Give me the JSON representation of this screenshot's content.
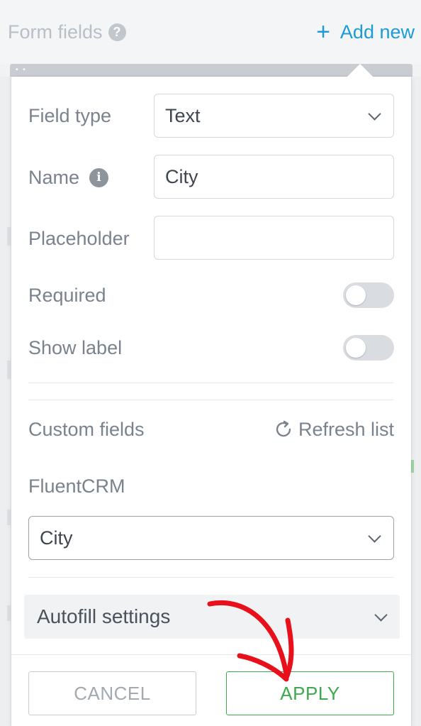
{
  "background": {
    "title": "Form fields",
    "add_new_label": "Add new"
  },
  "popover": {
    "field_type": {
      "label": "Field type",
      "value": "Text"
    },
    "name": {
      "label": "Name",
      "value": "City"
    },
    "placeholder": {
      "label": "Placeholder",
      "value": ""
    },
    "required": {
      "label": "Required",
      "on": false
    },
    "show_label": {
      "label": "Show label",
      "on": false
    },
    "custom_fields": {
      "label": "Custom fields",
      "refresh_label": "Refresh list"
    },
    "fluentcrm": {
      "label": "FluentCRM",
      "value": "City"
    },
    "autofill": {
      "label": "Autofill settings"
    },
    "buttons": {
      "cancel": "CANCEL",
      "apply": "APPLY"
    }
  },
  "colors": {
    "accent_blue": "#1e9ad6",
    "apply_green": "#3cab4c",
    "annotation_red": "#e8101b"
  }
}
